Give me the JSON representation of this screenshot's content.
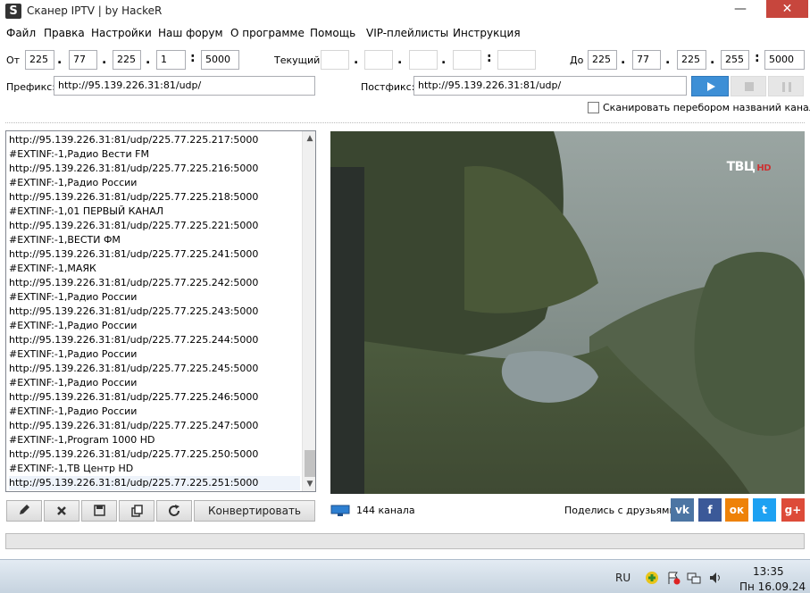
{
  "window": {
    "title": "Сканер IPTV | by HackeR",
    "icon": "S",
    "close": "✕",
    "minimize": "—",
    "maximize": "❐"
  },
  "menu": [
    "Файл",
    "Правка",
    "Настройки",
    "Наш форум",
    "О программе",
    "Помощь",
    "VIP-плейлисты",
    "Инструкция"
  ],
  "range": {
    "from_label": "От",
    "from": [
      "225",
      "77",
      "225",
      "1"
    ],
    "from_port": "5000",
    "current_label": "Текущий:",
    "current": [
      "",
      "",
      "",
      ""
    ],
    "current_port": "",
    "to_label": "До",
    "to": [
      "225",
      "77",
      "225",
      "255"
    ],
    "to_port": "5000"
  },
  "prefix": {
    "label": "Префикс:",
    "value": "http://95.139.226.31:81/udp/"
  },
  "postfix": {
    "label": "Постфикс:",
    "value": "http://95.139.226.31:81/udp/"
  },
  "scan_by_names": {
    "label": "Сканировать перебором названий каналов",
    "checked": false
  },
  "playlist": [
    "http://95.139.226.31:81/udp/225.77.225.217:5000",
    "#EXTINF:-1,Радио Вести FM",
    "http://95.139.226.31:81/udp/225.77.225.216:5000",
    "#EXTINF:-1,Радио России",
    "http://95.139.226.31:81/udp/225.77.225.218:5000",
    "#EXTINF:-1,01 ПЕРВЫЙ КАНАЛ",
    "http://95.139.226.31:81/udp/225.77.225.221:5000",
    "#EXTINF:-1,ВЕСТИ ФМ",
    "http://95.139.226.31:81/udp/225.77.225.241:5000",
    "#EXTINF:-1,МАЯК",
    "http://95.139.226.31:81/udp/225.77.225.242:5000",
    "#EXTINF:-1,Радио России",
    "http://95.139.226.31:81/udp/225.77.225.243:5000",
    "#EXTINF:-1,Радио России",
    "http://95.139.226.31:81/udp/225.77.225.244:5000",
    "#EXTINF:-1,Радио России",
    "http://95.139.226.31:81/udp/225.77.225.245:5000",
    "#EXTINF:-1,Радио России",
    "http://95.139.226.31:81/udp/225.77.225.246:5000",
    "#EXTINF:-1,Радио России",
    "http://95.139.226.31:81/udp/225.77.225.247:5000",
    "#EXTINF:-1,Program 1000 HD",
    "http://95.139.226.31:81/udp/225.77.225.250:5000",
    "#EXTINF:-1,ТВ Центр HD",
    "http://95.139.226.31:81/udp/225.77.225.251:5000"
  ],
  "video": {
    "channel_logo": "ТВЦ",
    "channel_logo_suffix": "HD"
  },
  "toolbar": {
    "convert_label": "Конвертировать"
  },
  "status": {
    "channel_count": "144 канала",
    "share_label": "Поделись с друзьями:"
  },
  "social": [
    {
      "name": "vk",
      "glyph": "vk",
      "color": "#4c75a3"
    },
    {
      "name": "facebook",
      "glyph": "f",
      "color": "#3b5998"
    },
    {
      "name": "odnoklassniki",
      "glyph": "ок",
      "color": "#ee8208"
    },
    {
      "name": "twitter",
      "glyph": "t",
      "color": "#1da1f2"
    },
    {
      "name": "google-plus",
      "glyph": "g+",
      "color": "#dd4b39"
    }
  ],
  "progress": {
    "fraction": 0
  },
  "taskbar": {
    "language": "RU",
    "time": "13:35",
    "date": "Пн 16.09.24"
  },
  "colors": {
    "accent": "#3d8fd6",
    "close": "#c7463d"
  }
}
